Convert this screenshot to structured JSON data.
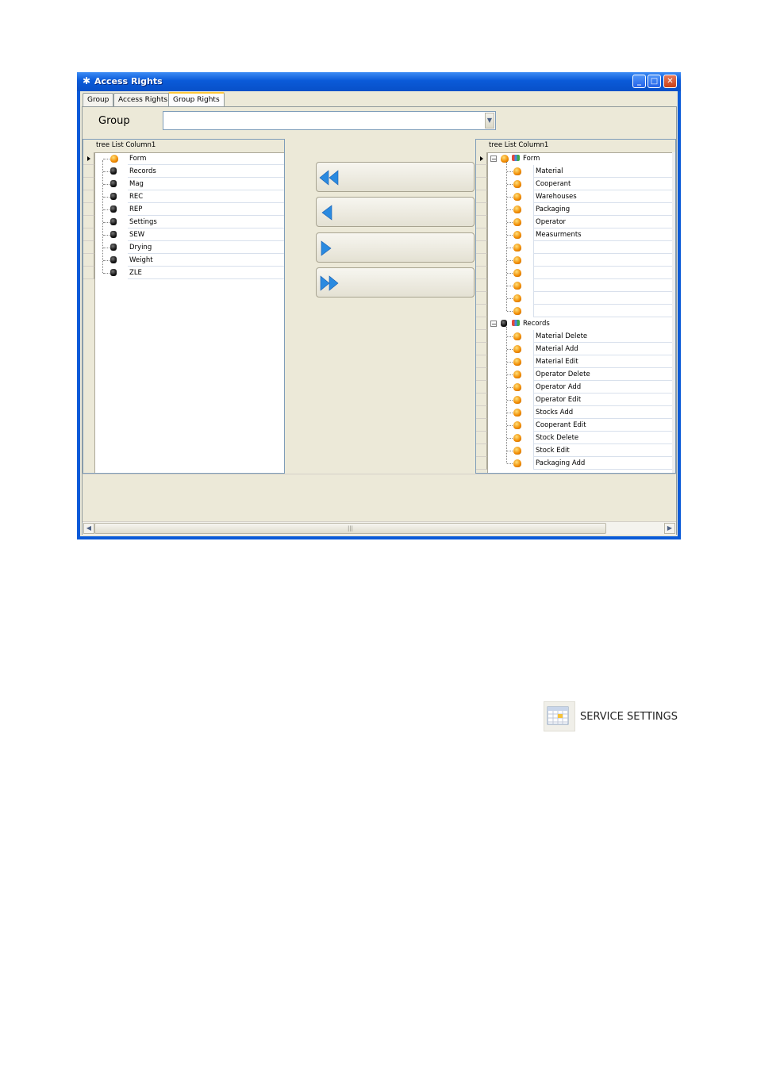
{
  "window": {
    "title": "Access Rights",
    "controls": [
      "minimize-icon",
      "maximize-icon",
      "close-icon"
    ]
  },
  "tabs": [
    {
      "label": "Group",
      "active": false
    },
    {
      "label": "Access Rights",
      "active": false
    },
    {
      "label": "Group Rights",
      "active": true
    }
  ],
  "group": {
    "label": "Group",
    "value": ""
  },
  "left_tree": {
    "column_header": "tree List Column1",
    "items": [
      {
        "label": "Form",
        "icon": "orange-ball-icon"
      },
      {
        "label": "Records",
        "icon": "black-ball-icon"
      },
      {
        "label": "Mag",
        "icon": "black-ball-icon"
      },
      {
        "label": "REC",
        "icon": "black-ball-icon"
      },
      {
        "label": "REP",
        "icon": "black-ball-icon"
      },
      {
        "label": "Settings",
        "icon": "black-ball-icon"
      },
      {
        "label": "SEW",
        "icon": "black-ball-icon"
      },
      {
        "label": "Drying",
        "icon": "black-ball-icon"
      },
      {
        "label": "Weight",
        "icon": "black-ball-icon"
      },
      {
        "label": "ZLE",
        "icon": "black-ball-icon"
      }
    ]
  },
  "right_tree": {
    "column_header": "tree List Column1",
    "groups": [
      {
        "label": "Form",
        "expander": "−",
        "children": [
          "Material",
          "Cooperant",
          "Warehouses",
          "Packaging",
          "Operator",
          "Measurments",
          "",
          "",
          "",
          "",
          "",
          ""
        ]
      },
      {
        "label": "Records",
        "expander": "−",
        "children": [
          "Material Delete",
          "Material Add",
          "Material Edit",
          "Operator Delete",
          "Operator Add",
          "Operator Edit",
          "Stocks Add",
          "Cooperant Edit",
          "Stock Delete",
          "Stock Edit",
          "Packaging Add"
        ]
      }
    ]
  },
  "transfer_buttons": [
    {
      "name": "move-all-left",
      "icon": "double-arrow-left-icon"
    },
    {
      "name": "move-left",
      "icon": "arrow-left-icon"
    },
    {
      "name": "move-right",
      "icon": "arrow-right-icon"
    },
    {
      "name": "move-all-right",
      "icon": "double-arrow-right-icon"
    }
  ],
  "service_settings": {
    "label": "SERVICE SETTINGS",
    "icon": "calendar-grid-icon"
  },
  "colors": {
    "title_bar": "#0a5ad8",
    "arrow_blue": "#2a8ae0",
    "window_bg": "#ece9d8"
  }
}
